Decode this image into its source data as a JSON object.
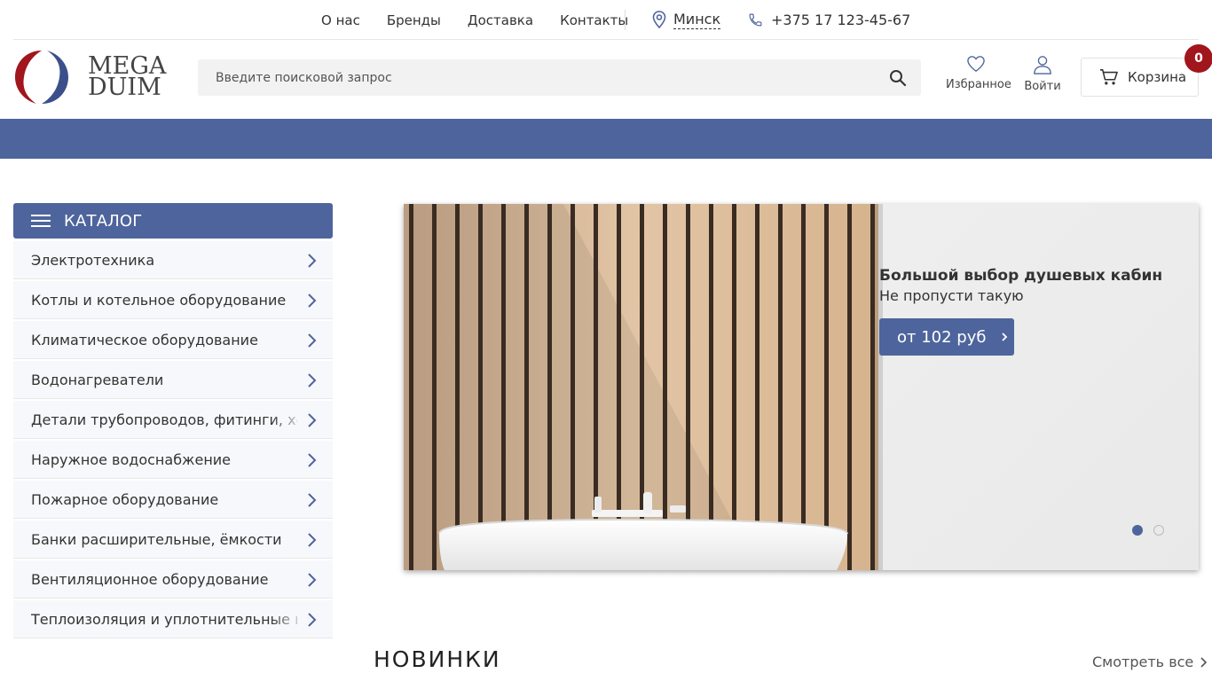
{
  "topnav": {
    "links": [
      "О нас",
      "Бренды",
      "Доставка",
      "Контакты"
    ],
    "city": "Минск",
    "phone": "+375 17 123-45-67"
  },
  "logo": {
    "line1": "MEGA",
    "line2": "DUIM"
  },
  "search": {
    "placeholder": "Введите поисковой запрос"
  },
  "header": {
    "favorites_label": "Избранное",
    "login_label": "Войти",
    "cart_label": "Корзина",
    "cart_count": "0"
  },
  "catalog": {
    "title": "КАТАЛОГ",
    "items": [
      "Электротехника",
      "Котлы и котельное оборудование",
      "Климатическое оборудование",
      "Водонагреватели",
      "Детали трубопроводов, фитинги, хомуты",
      "Наружное водоснабжение",
      "Пожарное оборудование",
      "Банки расширительные, ёмкости",
      "Вентиляционное оборудование",
      "Теплоизоляция и уплотнительные материалы"
    ]
  },
  "banner": {
    "title": "Большой выбор душевых кабин",
    "subtitle": "Не пропусти такую",
    "button_label": "от 102 руб",
    "slides_total": 2,
    "active_slide": 1
  },
  "section": {
    "title": "НОВИНКИ",
    "see_all": "Смотреть все"
  },
  "colors": {
    "brand_blue": "#4e649c",
    "badge_red": "#a1151c"
  }
}
